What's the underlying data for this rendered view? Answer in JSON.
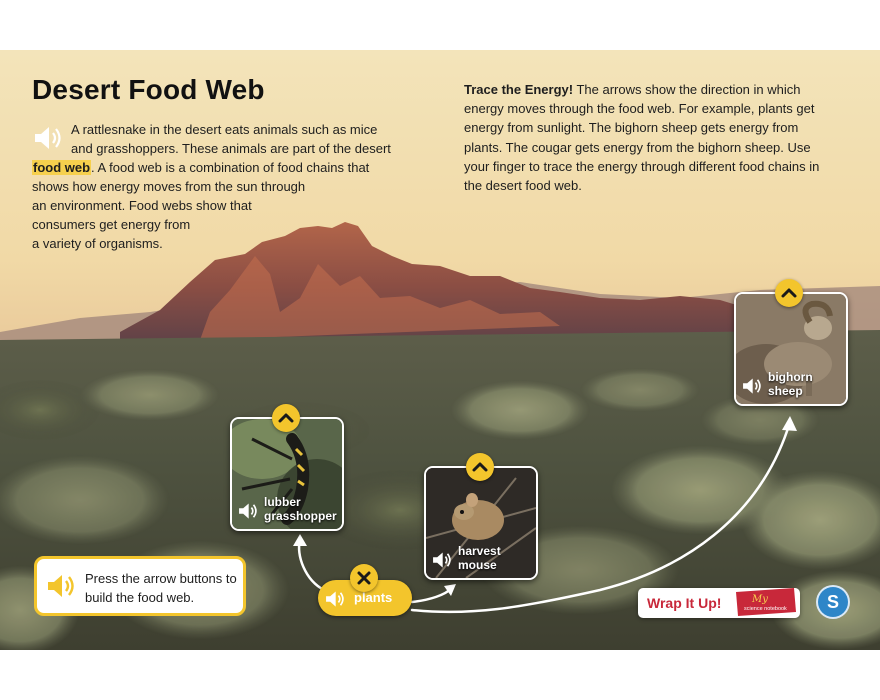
{
  "title": "Desert Food Web",
  "intro": {
    "lines": [
      "A rattlesnake in the desert eats animals such as mice",
      "and grasshoppers. These animals are part of the desert",
      ". A food web is a combination of food chains that",
      "shows how energy moves from the sun through",
      "an environment. Food webs show that",
      "consumers get energy from",
      "a variety of organisms."
    ],
    "highlight_term": "food web",
    "speaker_icon": "speaker-icon"
  },
  "trace": {
    "heading": "Trace the Energy!",
    "text": " The arrows show the direction in which energy moves through the food web. For example, plants get energy from sunlight. The bighorn sheep gets energy from plants. The cougar gets energy from the bighorn sheep. Use your finger to trace the energy through different food chains in the desert food web."
  },
  "organisms": [
    {
      "id": "lubber-grasshopper",
      "line1": "lubber",
      "line2": "grasshopper"
    },
    {
      "id": "harvest-mouse",
      "line1": "harvest",
      "line2": "mouse"
    },
    {
      "id": "bighorn-sheep",
      "line1": "bighorn",
      "line2": "sheep"
    }
  ],
  "plants": {
    "label": "plants"
  },
  "hint": {
    "text": "Press the arrow buttons to build the food web."
  },
  "wrap_up": {
    "label": "Wrap It Up!",
    "notebook_text": "science notebook",
    "notebook_my": "My"
  },
  "badge": {
    "letter": "S"
  },
  "colors": {
    "accent_yellow": "#f3c52c",
    "wrap_red": "#c8283a",
    "badge_blue": "#2e86c8"
  }
}
